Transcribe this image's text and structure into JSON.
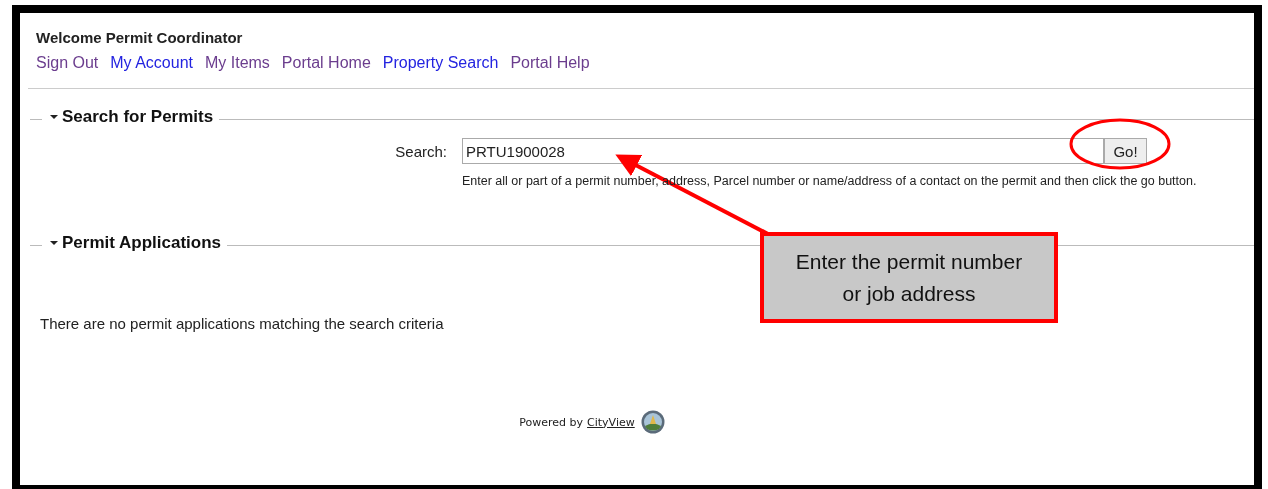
{
  "header": {
    "welcome": "Welcome Permit Coordinator",
    "links": [
      {
        "label": "Sign Out",
        "visited": true
      },
      {
        "label": "My Account",
        "visited": false
      },
      {
        "label": "My Items",
        "visited": true
      },
      {
        "label": "Portal Home",
        "visited": true
      },
      {
        "label": "Property Search",
        "visited": false
      },
      {
        "label": "Portal Help",
        "visited": true
      }
    ]
  },
  "search_section": {
    "title": "Search for Permits",
    "expanded": true,
    "label": "Search:",
    "value": "PRTU1900028",
    "button": "Go!",
    "help": "Enter all or part of a permit number, address, Parcel number or name/address of a contact on the permit and then click the go button."
  },
  "applications_section": {
    "title": "Permit Applications",
    "expanded": true,
    "message": "There are no permit applications matching the search criteria"
  },
  "footer": {
    "powered_by": "Powered by",
    "link": "CityView"
  },
  "annotation": {
    "callout": "Enter the permit number or job address"
  }
}
